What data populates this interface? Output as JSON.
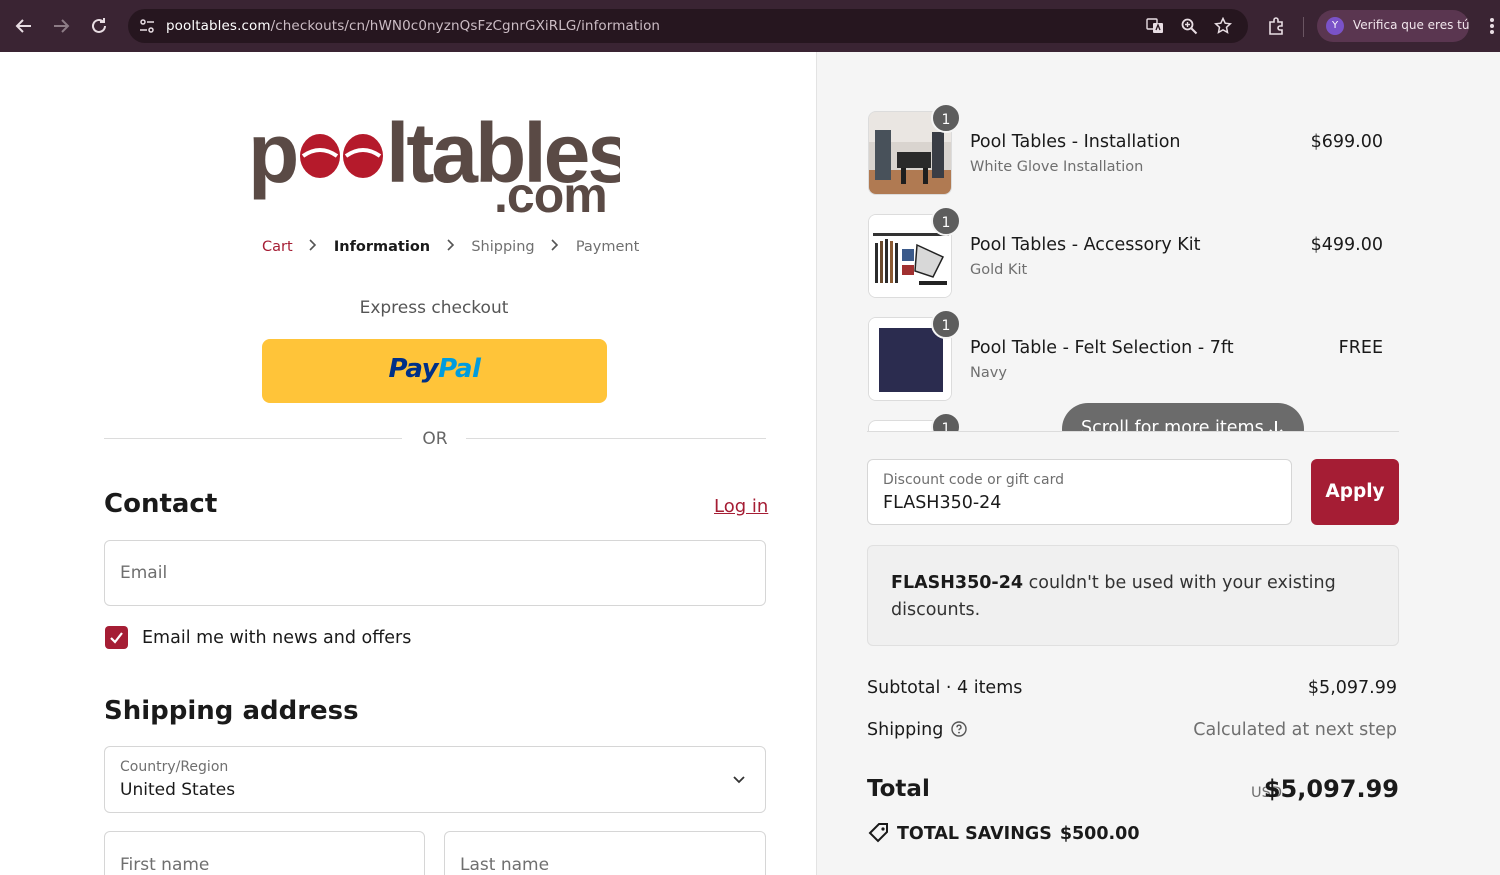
{
  "browser": {
    "url_host": "pooltables.com",
    "url_path": "/checkouts/cn/hWN0c0nyznQsFzCgnrGXiRLG/information",
    "profile_initial": "Y",
    "profile_label": "Verifica que eres tú",
    "icons": [
      "back-arrow-icon",
      "forward-arrow-icon",
      "reload-icon",
      "site-info-icon",
      "translate-icon",
      "zoom-icon",
      "bookmark-star-icon",
      "extensions-icon",
      "kebab-menu-icon"
    ]
  },
  "brand": {
    "logo_text": "pooltables.com"
  },
  "breadcrumb": {
    "cart": "Cart",
    "information": "Information",
    "shipping": "Shipping",
    "payment": "Payment"
  },
  "express": {
    "label": "Express checkout",
    "paypal_part1": "Pay",
    "paypal_part2": "Pal"
  },
  "divider_or": "OR",
  "contact": {
    "heading": "Contact",
    "login_link": "Log in",
    "email_placeholder": "Email",
    "newsletter_checked": true,
    "newsletter_label": "Email me with news and offers"
  },
  "shipping_address": {
    "heading": "Shipping address",
    "country_label": "Country/Region",
    "country_value": "United States",
    "first_name_placeholder": "First name",
    "last_name_placeholder": "Last name"
  },
  "order": {
    "items": [
      {
        "qty": "1",
        "title": "Pool Tables - Installation",
        "variant": "White Glove Installation",
        "price": "$699.00"
      },
      {
        "qty": "1",
        "title": "Pool Tables - Accessory Kit",
        "variant": "Gold Kit",
        "price": "$499.00"
      },
      {
        "qty": "1",
        "title": "Pool Table - Felt Selection - 7ft",
        "variant": "Navy",
        "price": "FREE"
      },
      {
        "qty": "1",
        "title": "",
        "variant": "",
        "price": ""
      }
    ],
    "scroll_hint": "Scroll for more items"
  },
  "discount": {
    "label": "Discount code or gift card",
    "value": "FLASH350-24",
    "apply": "Apply",
    "error_code": "FLASH350-24",
    "error_message": "couldn't be used with your existing discounts."
  },
  "summary": {
    "subtotal_label": "Subtotal · 4 items",
    "subtotal_value": "$5,097.99",
    "shipping_label": "Shipping",
    "shipping_value": "Calculated at next step",
    "total_label": "Total",
    "total_currency": "USD",
    "total_value": "$5,097.99",
    "savings_label": "TOTAL SAVINGS",
    "savings_value": "$500.00"
  },
  "colors": {
    "accent": "#a51d34",
    "chrome": "#3a2433",
    "paypal_yellow": "#ffc439"
  }
}
